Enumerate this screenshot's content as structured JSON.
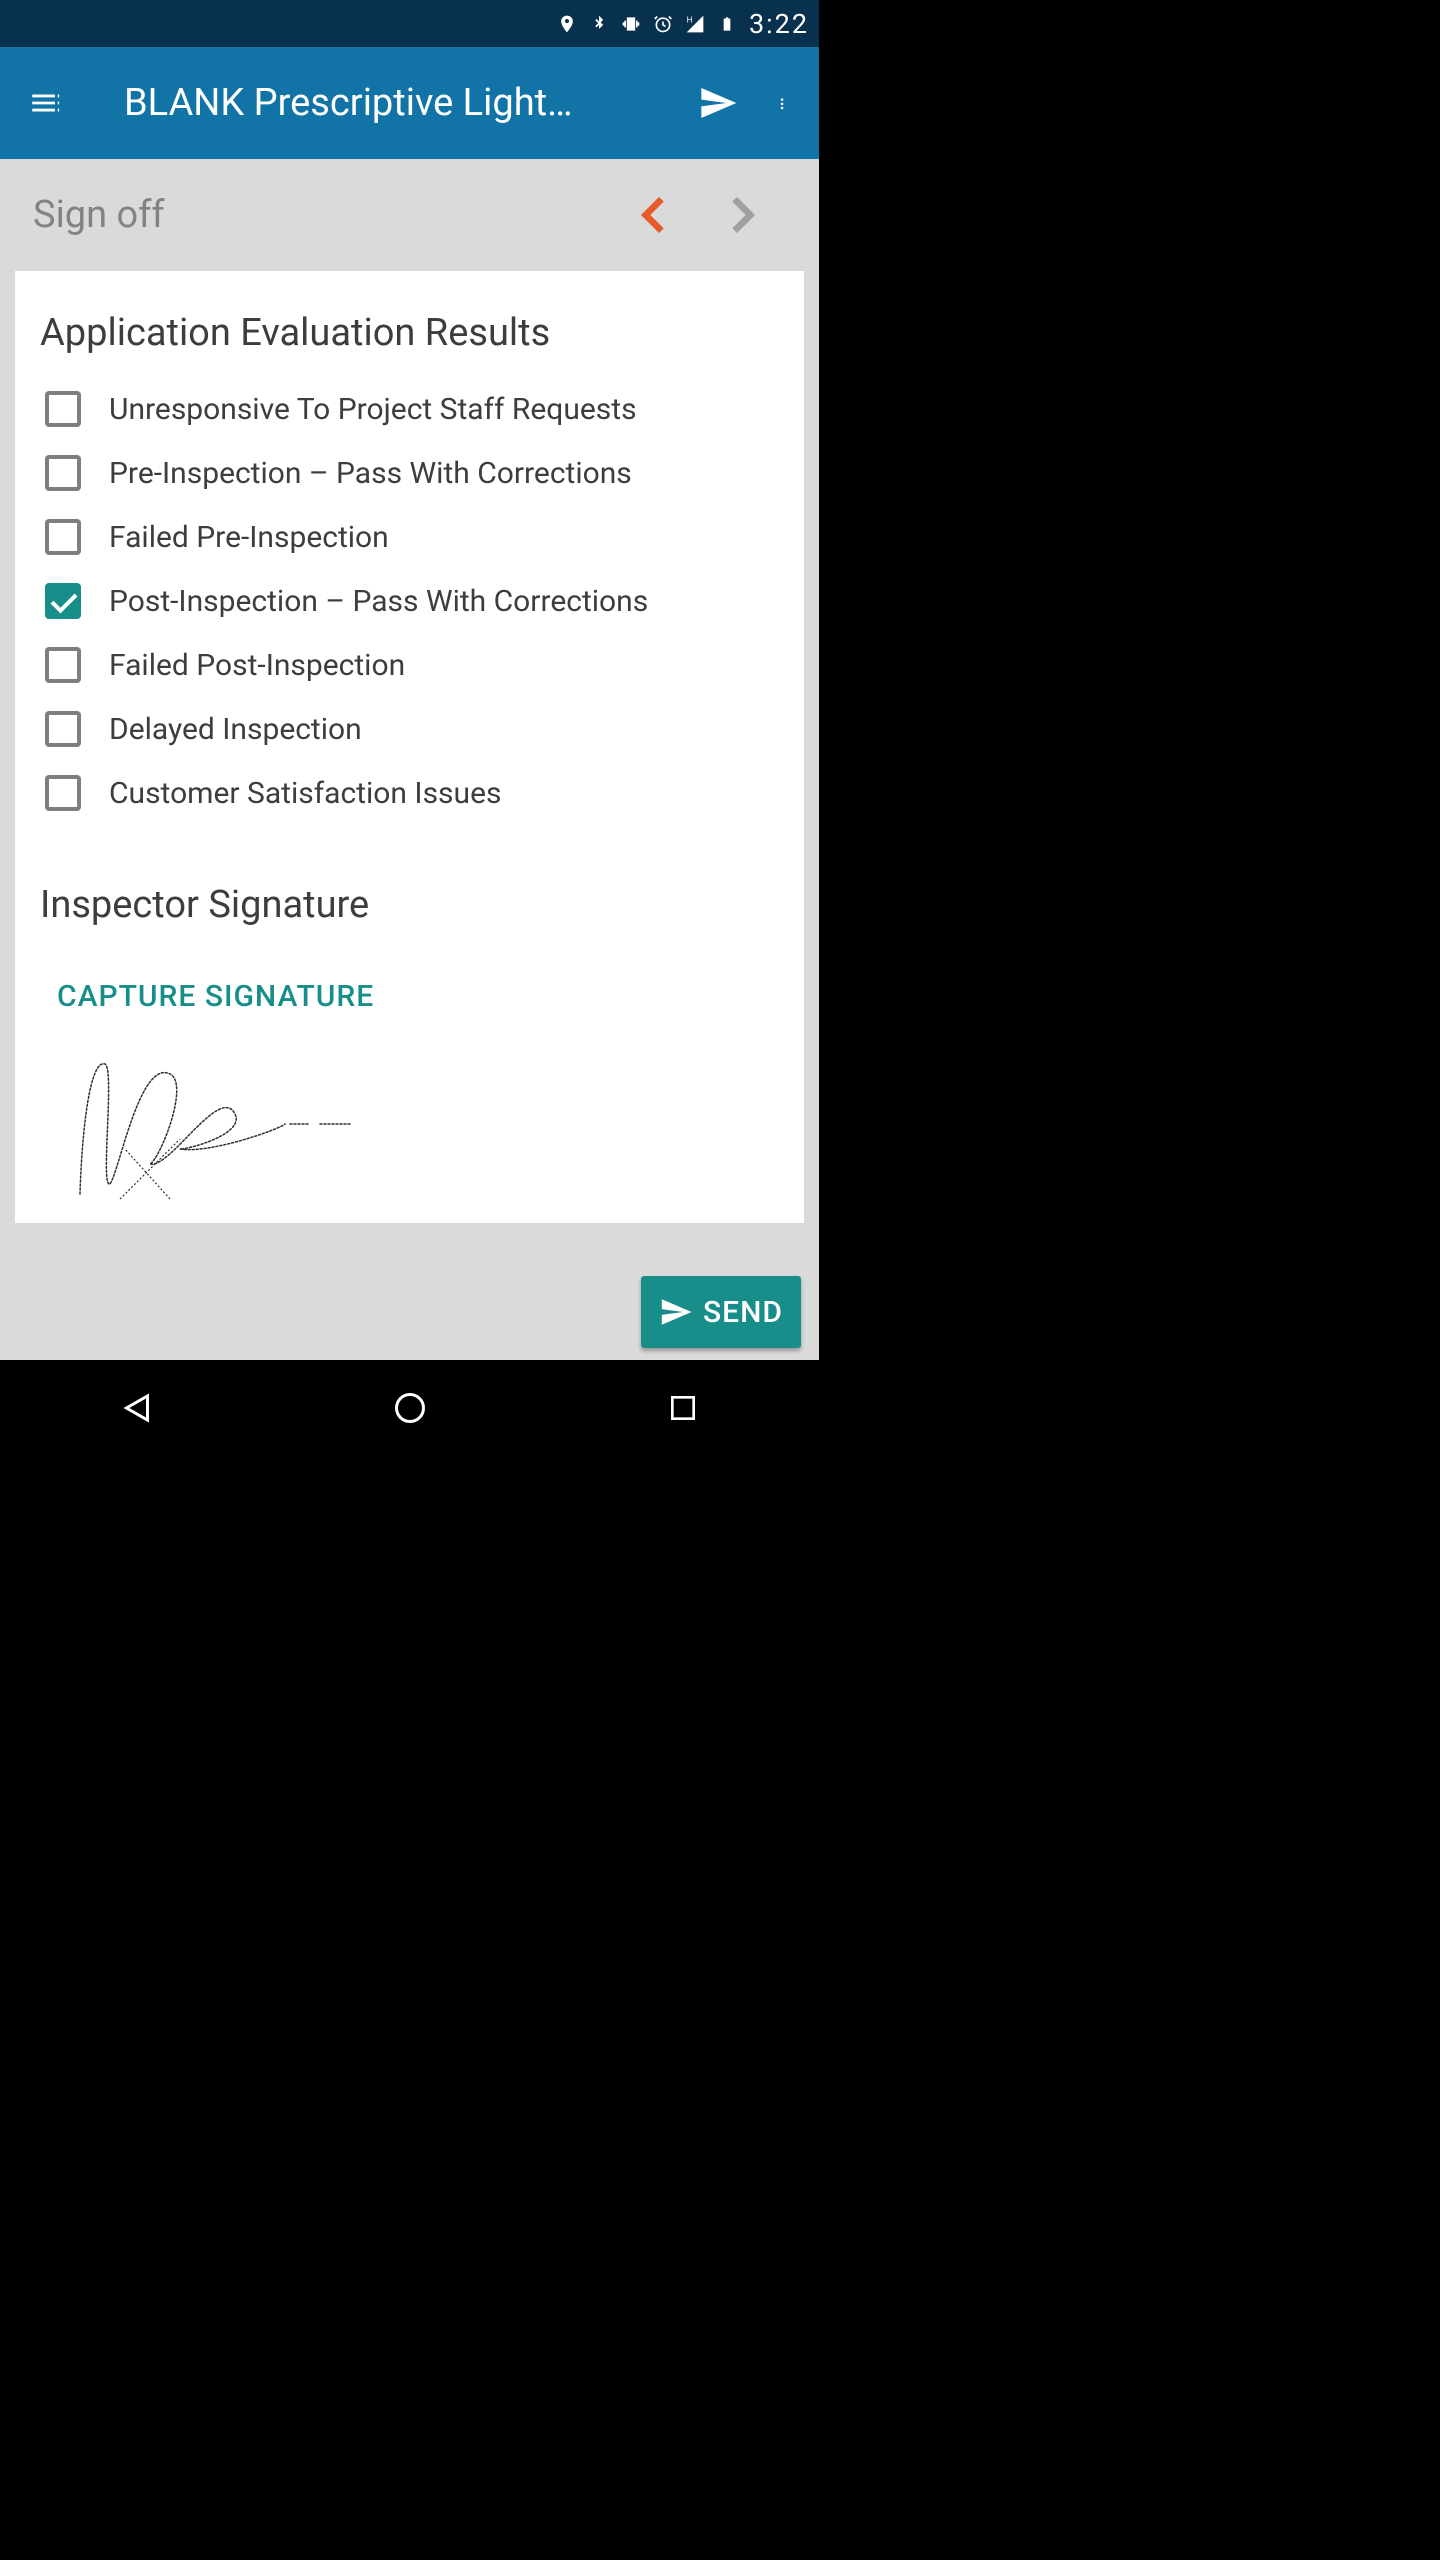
{
  "status": {
    "time": "3:22"
  },
  "appbar": {
    "title": "BLANK Prescriptive Light…"
  },
  "section": {
    "title": "Sign off"
  },
  "card": {
    "heading": "Application Evaluation Results",
    "items": [
      {
        "label": "Unresponsive To Project Staff Requests",
        "checked": false
      },
      {
        "label": "Pre-Inspection – Pass With Corrections",
        "checked": false
      },
      {
        "label": "Failed Pre-Inspection",
        "checked": false
      },
      {
        "label": "Post-Inspection – Pass With Corrections",
        "checked": true
      },
      {
        "label": "Failed Post-Inspection",
        "checked": false
      },
      {
        "label": "Delayed Inspection",
        "checked": false
      },
      {
        "label": "Customer Satisfaction Issues",
        "checked": false
      }
    ]
  },
  "signature": {
    "heading": "Inspector Signature",
    "button_label": "CAPTURE SIGNATURE"
  },
  "footer": {
    "send_label": "SEND"
  },
  "colors": {
    "accent": "#188e8b",
    "appbar": "#1173a6",
    "chevron_prev": "#e55b29",
    "chevron_next": "#a0a0a0"
  }
}
